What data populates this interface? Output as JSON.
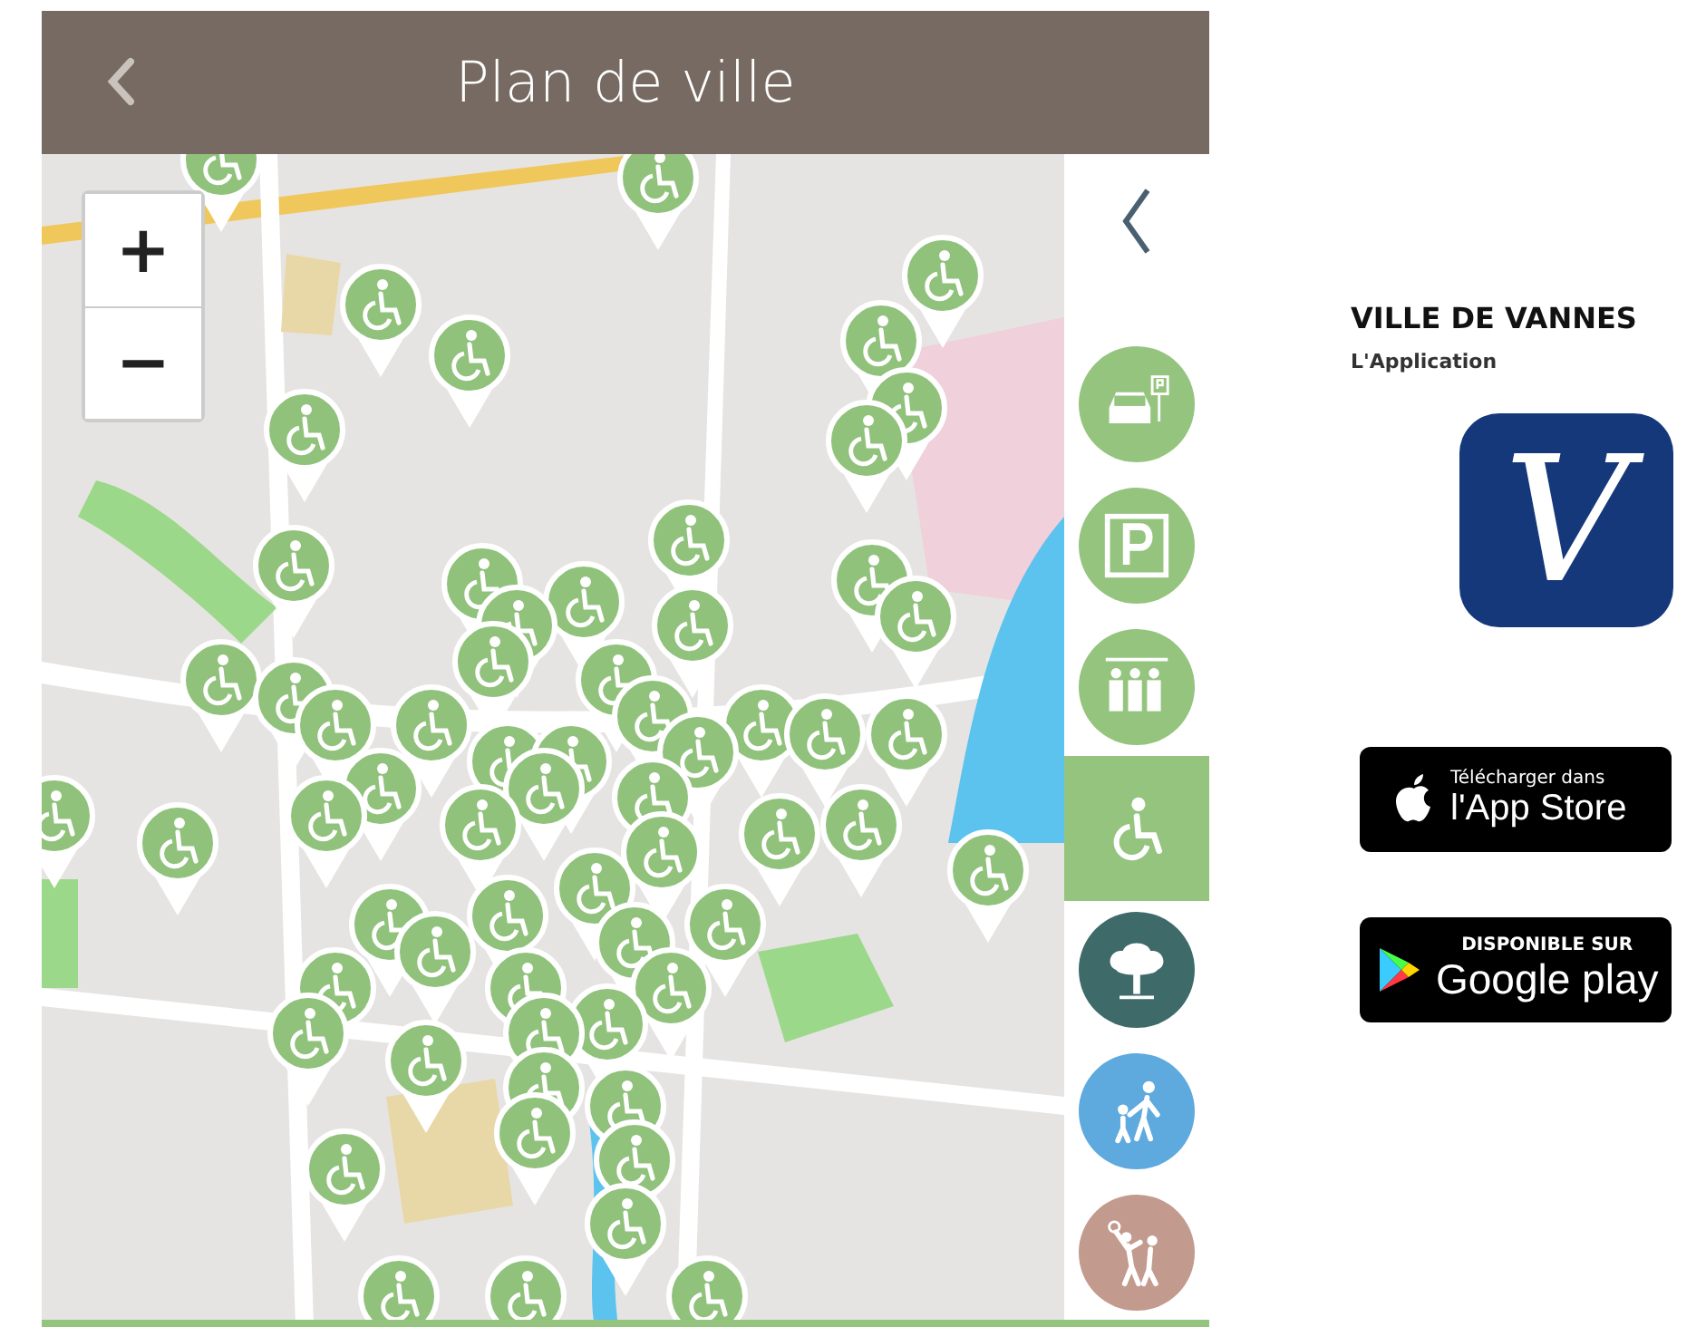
{
  "header": {
    "title": "Plan de ville"
  },
  "zoom_controls": {
    "zoom_in": "+",
    "zoom_out": "−"
  },
  "layers": [
    {
      "kind": "car-parking",
      "selected": false,
      "color": "#95c47f"
    },
    {
      "kind": "parking",
      "selected": false,
      "color": "#95c47f"
    },
    {
      "kind": "transit",
      "selected": false,
      "color": "#95c47f"
    },
    {
      "kind": "accessibility",
      "selected": true,
      "color": "#95c47f"
    },
    {
      "kind": "park",
      "selected": false,
      "color": "#3e6b6a"
    },
    {
      "kind": "family",
      "selected": false,
      "color": "#5ea9de"
    },
    {
      "kind": "sports",
      "selected": false,
      "color": "#c29a8e"
    }
  ],
  "promo": {
    "title": "VILLE DE VANNES",
    "subtitle": "L'Application",
    "app_icon_letter": "V",
    "badges": [
      {
        "kind": "apple",
        "small": "Télécharger dans",
        "large": "l'App Store"
      },
      {
        "kind": "google",
        "small": "DISPONIBLE SUR",
        "large": "Google play"
      }
    ]
  }
}
